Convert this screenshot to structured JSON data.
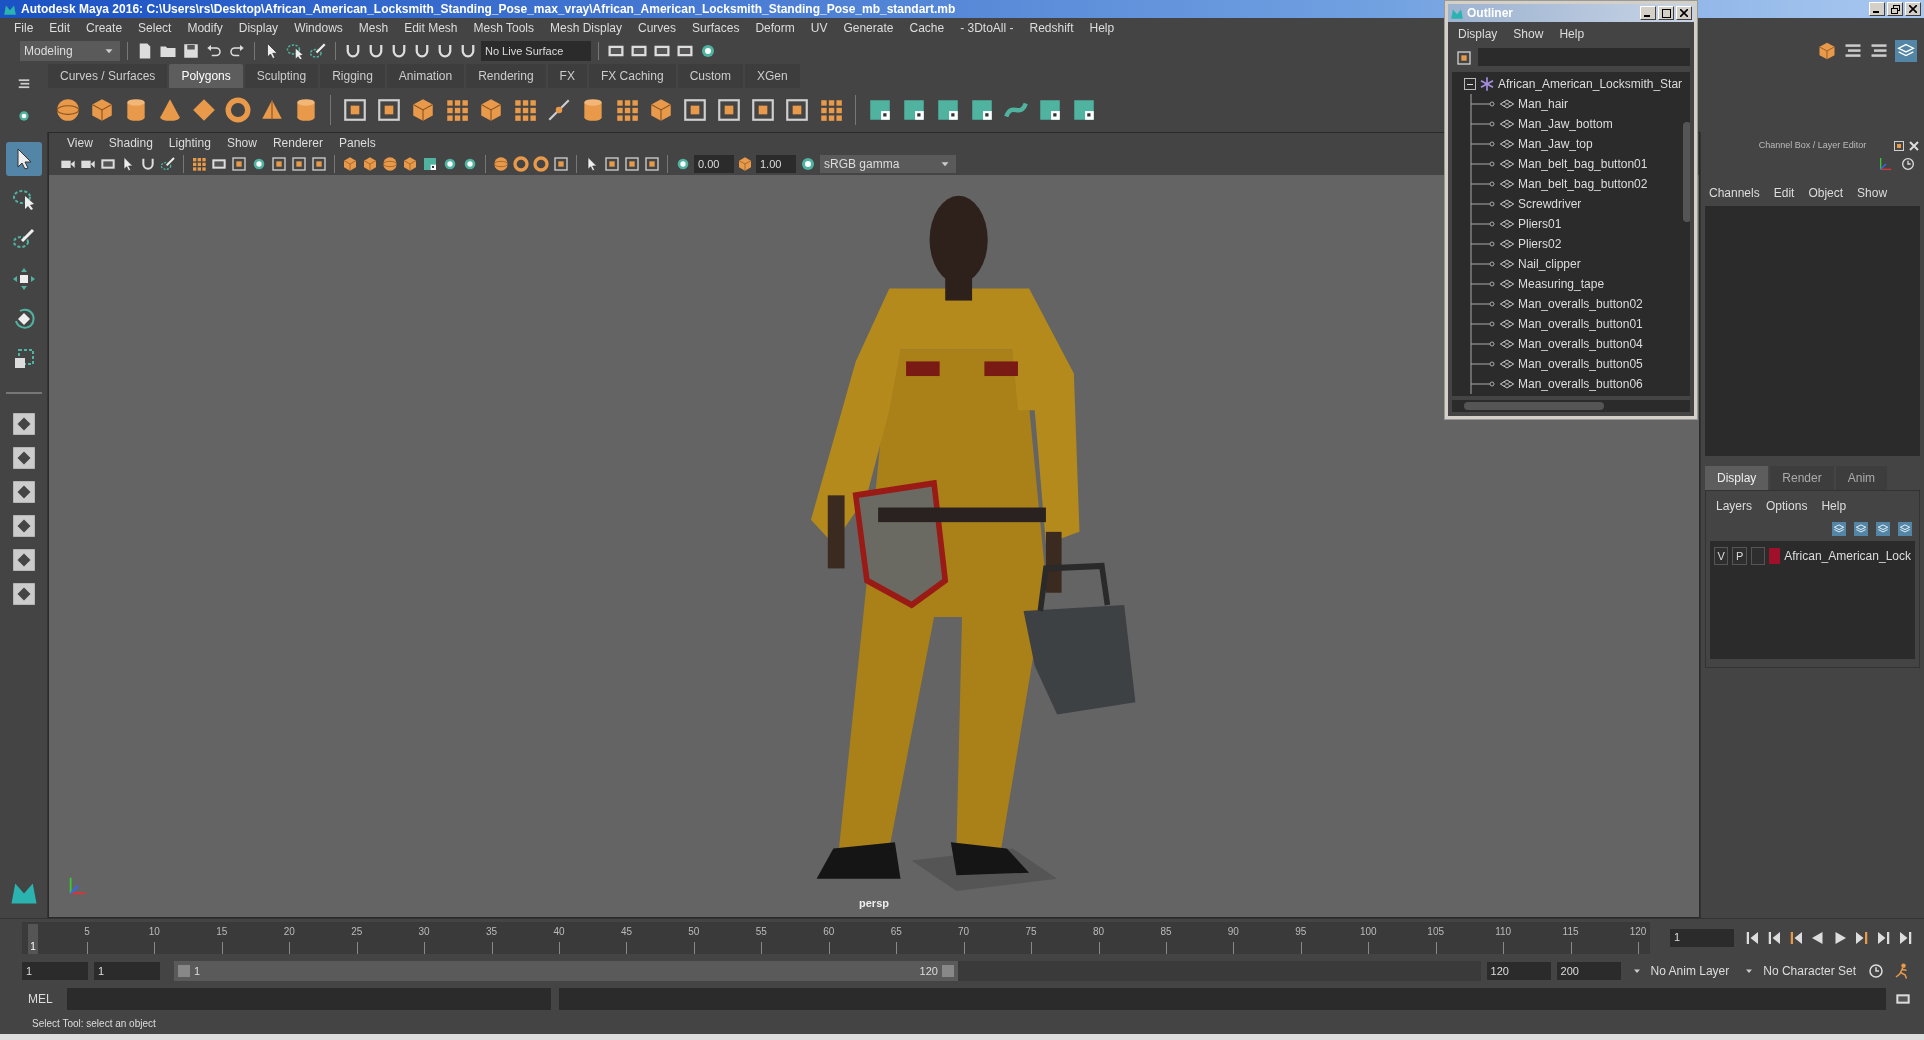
{
  "window": {
    "title": "Autodesk Maya 2016: C:\\Users\\rs\\Desktop\\African_American_Locksmith_Standing_Pose_max_vray\\African_American_Locksmith_Standing_Pose_mb_standart.mb"
  },
  "menu_bar": [
    "File",
    "Edit",
    "Create",
    "Select",
    "Modify",
    "Display",
    "Windows",
    "Mesh",
    "Edit Mesh",
    "Mesh Tools",
    "Mesh Display",
    "Curves",
    "Surfaces",
    "Deform",
    "UV",
    "Generate",
    "Cache",
    "- 3DtoAll -",
    "Redshift",
    "Help"
  ],
  "status_line": {
    "mode": "Modeling",
    "live_surface": "No Live Surface"
  },
  "shelf": {
    "tabs": [
      {
        "label": "Curves / Surfaces",
        "selected": false
      },
      {
        "label": "Polygons",
        "selected": true
      },
      {
        "label": "Sculpting",
        "selected": false
      },
      {
        "label": "Rigging",
        "selected": false
      },
      {
        "label": "Animation",
        "selected": false
      },
      {
        "label": "Rendering",
        "selected": false
      },
      {
        "label": "FX",
        "selected": false
      },
      {
        "label": "FX Caching",
        "selected": false
      },
      {
        "label": "Custom",
        "selected": false
      },
      {
        "label": "XGen",
        "selected": false
      }
    ]
  },
  "toolbox": {
    "tools": [
      {
        "kind": "select",
        "selected": true
      },
      {
        "kind": "lasso",
        "selected": false
      },
      {
        "kind": "paint",
        "selected": false
      },
      {
        "kind": "move",
        "selected": false
      },
      {
        "kind": "rotate",
        "selected": false
      },
      {
        "kind": "scale",
        "selected": false
      }
    ]
  },
  "viewport": {
    "menu": [
      "View",
      "Shading",
      "Lighting",
      "Show",
      "Renderer",
      "Panels"
    ],
    "exposure": "0.00",
    "gamma": "1.00",
    "color_space": "sRGB gamma",
    "camera_label": "persp"
  },
  "outliner": {
    "title": "Outliner",
    "menu": [
      "Display",
      "Show",
      "Help"
    ],
    "root": {
      "label": "African_American_Locksmith_Star",
      "expanded": true,
      "children": [
        {
          "label": "Man_hair"
        },
        {
          "label": "Man_Jaw_bottom"
        },
        {
          "label": "Man_Jaw_top"
        },
        {
          "label": "Man_belt_bag_button01"
        },
        {
          "label": "Man_belt_bag_button02"
        },
        {
          "label": "Screwdriver"
        },
        {
          "label": "Pliers01"
        },
        {
          "label": "Pliers02"
        },
        {
          "label": "Nail_clipper"
        },
        {
          "label": "Measuring_tape"
        },
        {
          "label": "Man_overalls_button02"
        },
        {
          "label": "Man_overalls_button01"
        },
        {
          "label": "Man_overalls_button04"
        },
        {
          "label": "Man_overalls_button05"
        },
        {
          "label": "Man_overalls_button06"
        }
      ]
    }
  },
  "channel_box": {
    "title": "Channel Box / Layer Editor",
    "menu": [
      "Channels",
      "Edit",
      "Object",
      "Show"
    ]
  },
  "layer_editor": {
    "tabs": [
      {
        "label": "Display",
        "selected": true
      },
      {
        "label": "Render",
        "selected": false
      },
      {
        "label": "Anim",
        "selected": false
      }
    ],
    "menu": [
      "Layers",
      "Options",
      "Help"
    ],
    "layers": [
      {
        "visibility": "V",
        "playback": "P",
        "color": "#a0102a",
        "name": "African_American_Lock"
      }
    ]
  },
  "time_slider": {
    "ticks": [
      "5",
      "10",
      "15",
      "20",
      "25",
      "30",
      "35",
      "40",
      "45",
      "50",
      "55",
      "60",
      "65",
      "70",
      "75",
      "80",
      "85",
      "90",
      "95",
      "100",
      "105",
      "110",
      "115",
      "120"
    ],
    "current_frame": "1",
    "level": 0,
    "frame_field": "1"
  },
  "range_slider": {
    "start": "1",
    "playback_start": "1",
    "range_start": "1",
    "range_end": "120",
    "level": 0.6,
    "playback_end": "120",
    "end": "200",
    "anim_layer": "No Anim Layer",
    "character_set": "No Character Set"
  },
  "command_line": {
    "label": "MEL"
  },
  "help_line": "Select Tool: select an object"
}
